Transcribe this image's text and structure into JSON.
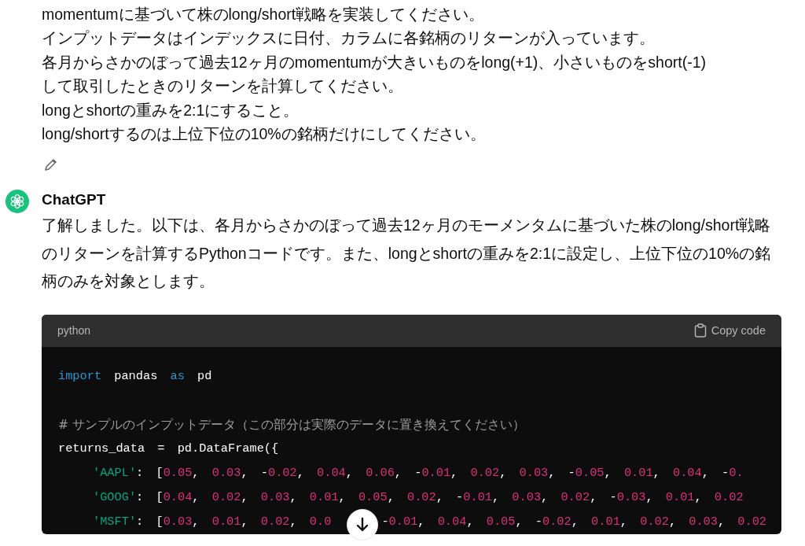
{
  "user_message": {
    "lines": [
      "momentumに基づいて株のlong/short戦略を実装してください。",
      "インプットデータはインデックスに日付、カラムに各銘柄のリターンが入っています。",
      "各月からさかのぼって過去12ヶ月のmomentumが大きいものをlong(+1)、小さいものをshort(-1)",
      "して取引したときのリターンを計算してください。",
      "longとshortの重みを2:1にすること。",
      "long/shortするのは上位下位の10%の銘柄だけにしてください。"
    ]
  },
  "assistant": {
    "name": "ChatGPT",
    "text": "了解しました。以下は、各月からさかのぼって過去12ヶ月のモーメンタムに基づいた株のlong/short戦略のリターンを計算するPythonコードです。また、longとshortの重みを2:1に設定し、上位下位の10%の銘柄のみを対象とします。",
    "code_block": {
      "language": "python",
      "copy_label": "Copy code",
      "lines": [
        {
          "indented": false,
          "blank_before": false,
          "tokens": [
            {
              "kind": "keyword",
              "text": "import"
            },
            {
              "kind": "plain",
              "text": " pandas "
            },
            {
              "kind": "keyword",
              "text": "as"
            },
            {
              "kind": "plain",
              "text": " pd"
            }
          ]
        },
        {
          "indented": false,
          "blank_before": true,
          "tokens": [
            {
              "kind": "comment",
              "text": "# サンプルのインプットデータ（この部分は実際のデータに置き換えてください）"
            }
          ]
        },
        {
          "indented": false,
          "blank_before": false,
          "tokens": [
            {
              "kind": "plain",
              "text": "returns_data = pd.DataFrame({"
            }
          ]
        },
        {
          "indented": true,
          "blank_before": false,
          "tokens": [
            {
              "kind": "string",
              "text": "'AAPL'"
            },
            {
              "kind": "plain",
              "text": ": ["
            },
            {
              "kind": "number",
              "text": "0.05"
            },
            {
              "kind": "plain",
              "text": ", "
            },
            {
              "kind": "number",
              "text": "0.03"
            },
            {
              "kind": "plain",
              "text": ", -"
            },
            {
              "kind": "number",
              "text": "0.02"
            },
            {
              "kind": "plain",
              "text": ", "
            },
            {
              "kind": "number",
              "text": "0.04"
            },
            {
              "kind": "plain",
              "text": ", "
            },
            {
              "kind": "number",
              "text": "0.06"
            },
            {
              "kind": "plain",
              "text": ", -"
            },
            {
              "kind": "number",
              "text": "0.01"
            },
            {
              "kind": "plain",
              "text": ", "
            },
            {
              "kind": "number",
              "text": "0.02"
            },
            {
              "kind": "plain",
              "text": ", "
            },
            {
              "kind": "number",
              "text": "0.03"
            },
            {
              "kind": "plain",
              "text": ", -"
            },
            {
              "kind": "number",
              "text": "0.05"
            },
            {
              "kind": "plain",
              "text": ", "
            },
            {
              "kind": "number",
              "text": "0.01"
            },
            {
              "kind": "plain",
              "text": ", "
            },
            {
              "kind": "number",
              "text": "0.04"
            },
            {
              "kind": "plain",
              "text": ", -"
            },
            {
              "kind": "number",
              "text": "0."
            }
          ]
        },
        {
          "indented": true,
          "blank_before": false,
          "tokens": [
            {
              "kind": "string",
              "text": "'GOOG'"
            },
            {
              "kind": "plain",
              "text": ": ["
            },
            {
              "kind": "number",
              "text": "0.04"
            },
            {
              "kind": "plain",
              "text": ", "
            },
            {
              "kind": "number",
              "text": "0.02"
            },
            {
              "kind": "plain",
              "text": ", "
            },
            {
              "kind": "number",
              "text": "0.03"
            },
            {
              "kind": "plain",
              "text": ", "
            },
            {
              "kind": "number",
              "text": "0.01"
            },
            {
              "kind": "plain",
              "text": ", "
            },
            {
              "kind": "number",
              "text": "0.05"
            },
            {
              "kind": "plain",
              "text": ", "
            },
            {
              "kind": "number",
              "text": "0.02"
            },
            {
              "kind": "plain",
              "text": ", -"
            },
            {
              "kind": "number",
              "text": "0.01"
            },
            {
              "kind": "plain",
              "text": ", "
            },
            {
              "kind": "number",
              "text": "0.03"
            },
            {
              "kind": "plain",
              "text": ", "
            },
            {
              "kind": "number",
              "text": "0.02"
            },
            {
              "kind": "plain",
              "text": ", -"
            },
            {
              "kind": "number",
              "text": "0.03"
            },
            {
              "kind": "plain",
              "text": ", "
            },
            {
              "kind": "number",
              "text": "0.01"
            },
            {
              "kind": "plain",
              "text": ", "
            },
            {
              "kind": "number",
              "text": "0.02"
            }
          ]
        },
        {
          "indented": true,
          "blank_before": false,
          "tokens": [
            {
              "kind": "string",
              "text": "'MSFT'"
            },
            {
              "kind": "plain",
              "text": ": ["
            },
            {
              "kind": "number",
              "text": "0.03"
            },
            {
              "kind": "plain",
              "text": ", "
            },
            {
              "kind": "number",
              "text": "0.01"
            },
            {
              "kind": "plain",
              "text": ", "
            },
            {
              "kind": "number",
              "text": "0.02"
            },
            {
              "kind": "plain",
              "text": ", "
            },
            {
              "kind": "number",
              "text": "0.0"
            }
          ],
          "tokens_after_gap": [
            {
              "kind": "plain",
              "text": "-"
            },
            {
              "kind": "number",
              "text": "0.01"
            },
            {
              "kind": "plain",
              "text": ", "
            },
            {
              "kind": "number",
              "text": "0.04"
            },
            {
              "kind": "plain",
              "text": ", "
            },
            {
              "kind": "number",
              "text": "0.05"
            },
            {
              "kind": "plain",
              "text": ", -"
            },
            {
              "kind": "number",
              "text": "0.02"
            },
            {
              "kind": "plain",
              "text": ", "
            },
            {
              "kind": "number",
              "text": "0.01"
            },
            {
              "kind": "plain",
              "text": ", "
            },
            {
              "kind": "number",
              "text": "0.02"
            },
            {
              "kind": "plain",
              "text": ", "
            },
            {
              "kind": "number",
              "text": "0.03"
            },
            {
              "kind": "plain",
              "text": ", "
            },
            {
              "kind": "number",
              "text": "0.02"
            }
          ]
        }
      ]
    }
  }
}
